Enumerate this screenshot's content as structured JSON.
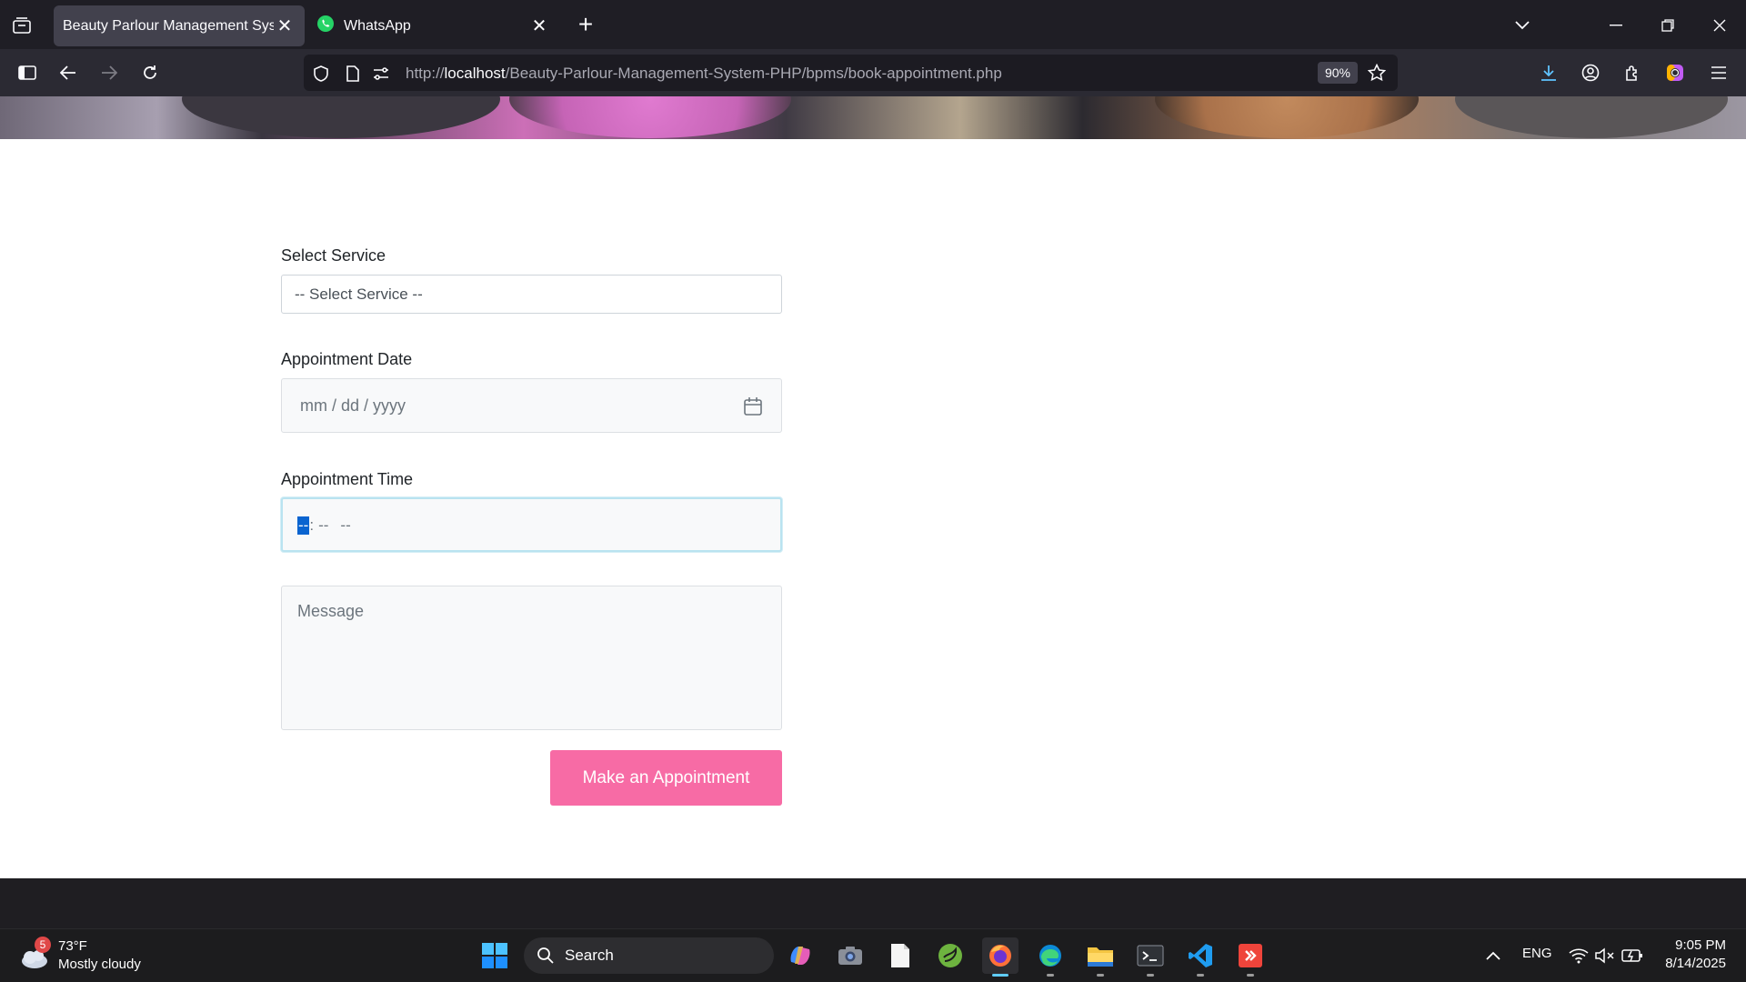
{
  "browser": {
    "tabs": [
      {
        "title": "Beauty Parlour Management System",
        "active": true
      },
      {
        "title": "WhatsApp",
        "active": false
      }
    ],
    "url": {
      "prefix": "http://",
      "host": "localhost",
      "path": "/Beauty-Parlour-Management-System-PHP/bpms/book-appointment.php"
    },
    "zoom": "90%"
  },
  "form": {
    "service_label": "Select Service",
    "service_value": "-- Select Service --",
    "date_label": "Appointment Date",
    "date_placeholder": "mm / dd / yyyy",
    "time_label": "Appointment Time",
    "time_hour": "--",
    "time_separator": ":",
    "time_minute": "--",
    "time_ampm": "--",
    "message_placeholder": "Message",
    "submit_label": "Make an Appointment",
    "accent_color": "#f76ba5"
  },
  "taskbar": {
    "weather": {
      "badge": "5",
      "temp": "73°F",
      "condition": "Mostly cloudy"
    },
    "search_label": "Search",
    "language": "ENG",
    "time": "9:05 PM",
    "date": "8/14/2025"
  }
}
